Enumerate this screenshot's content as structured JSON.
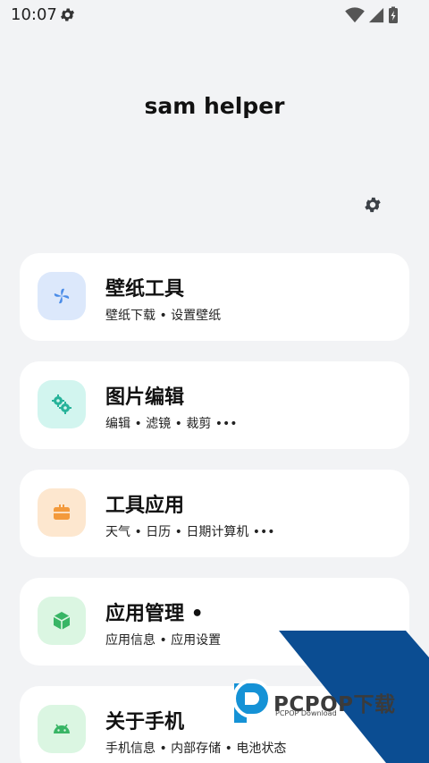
{
  "status_bar": {
    "time": "10:07",
    "icons": [
      "settings-icon",
      "wifi-icon",
      "signal-icon",
      "battery-charging-icon"
    ]
  },
  "app": {
    "title": "sam helper",
    "settings_icon": "gear-icon"
  },
  "cards": [
    {
      "title": "壁纸工具",
      "subtitle": "壁纸下载 • 设置壁纸",
      "icon": "pinwheel-icon",
      "icon_bg": "#dce8fb",
      "icon_color": "#4a8ce8"
    },
    {
      "title": "图片编辑",
      "subtitle": "编辑 • 滤镜 • 裁剪 •••",
      "icon": "gears-icon",
      "icon_bg": "#d2f5ef",
      "icon_color": "#27b39a"
    },
    {
      "title": "工具应用",
      "subtitle": "天气 • 日历 • 日期计算机 •••",
      "icon": "toolbox-icon",
      "icon_bg": "#fde7cf",
      "icon_color": "#f39a3c"
    },
    {
      "title": "应用管理 •",
      "subtitle": "应用信息 • 应用设置",
      "icon": "cube-icon",
      "icon_bg": "#dbf6e2",
      "icon_color": "#38b565"
    },
    {
      "title": "关于手机",
      "subtitle": "手机信息 • 内部存储 • 电池状态",
      "icon": "android-icon",
      "icon_bg": "#dbf6e2",
      "icon_color": "#38b565"
    }
  ],
  "watermark": {
    "text": "PCPOP下载",
    "subtext": "PCPOP Download",
    "color": "#0b4d92"
  }
}
